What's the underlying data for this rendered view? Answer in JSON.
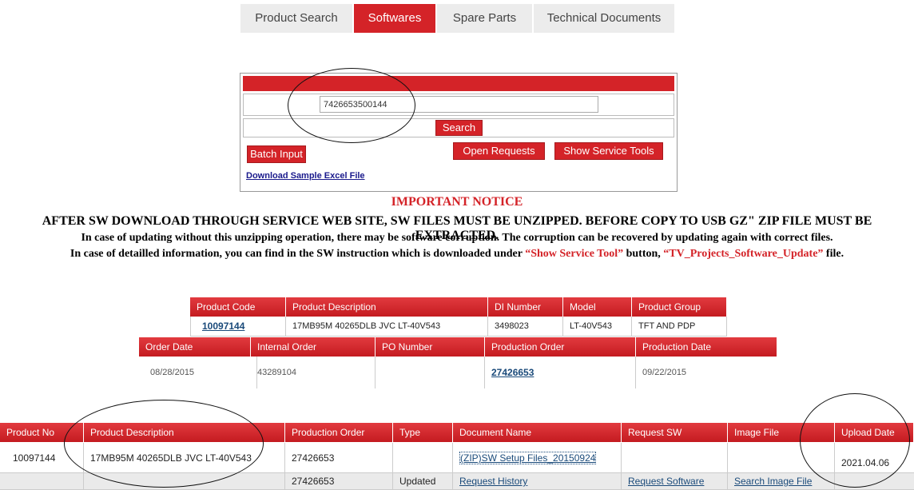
{
  "tabs": [
    {
      "label": "Product Search"
    },
    {
      "label": "Softwares"
    },
    {
      "label": "Spare Parts"
    },
    {
      "label": "Technical Documents"
    }
  ],
  "search": {
    "value": "7426653500144",
    "search_label": "Search",
    "batch_label": "Batch Input",
    "open_requests_label": "Open Requests",
    "service_tools_label": "Show Service Tools",
    "download_link": "Download Sample Excel File"
  },
  "notice": {
    "title": "IMPORTANT NOTICE",
    "line1": "AFTER SW DOWNLOAD THROUGH SERVICE WEB SITE, SW FILES MUST BE UNZIPPED. BEFORE COPY TO USB GZ\" ZIP FILE MUST BE EXTRACTED.",
    "line2": "In case of updating without this unzipping operation, there may be software corruption. The corruption can be recovered by updating again with correct files.",
    "line3_a": "In case of detailled information, you can find in the SW instruction which is downloaded under ",
    "line3_b": "“Show Service Tool”",
    "line3_c": " button, ",
    "line3_d": "“TV_Projects_Software_Update”",
    "line3_e": " file."
  },
  "product_table": {
    "headers": [
      "Product Code",
      "Product Description",
      "DI Number",
      "Model",
      "Product Group"
    ],
    "row": [
      "10097144",
      "17MB95M 40265DLB JVC LT-40V543",
      "3498023",
      "LT-40V543",
      "TFT AND PDP"
    ]
  },
  "order_table": {
    "headers": [
      "Order Date",
      "Internal Order",
      "PO Number",
      "Production Order",
      "Production Date"
    ],
    "row": [
      "08/28/2015",
      "43289104",
      "",
      "27426653",
      "09/22/2015"
    ]
  },
  "sw_table": {
    "headers": [
      "Product No",
      "Product Description",
      "Production Order",
      "Type",
      "Document Name",
      "Request SW",
      "Image File",
      "Upload Date"
    ],
    "row1": [
      "10097144",
      "17MB95M 40265DLB JVC LT-40V543",
      "27426653",
      "",
      "(ZIP)SW Setup Files_20150924",
      "",
      "",
      "2021.04.06"
    ],
    "row2": [
      "",
      "",
      "27426653",
      "Updated",
      "Request History",
      "Request Software",
      "Search Image File",
      ""
    ]
  },
  "colors": {
    "accent": "#d42328"
  }
}
